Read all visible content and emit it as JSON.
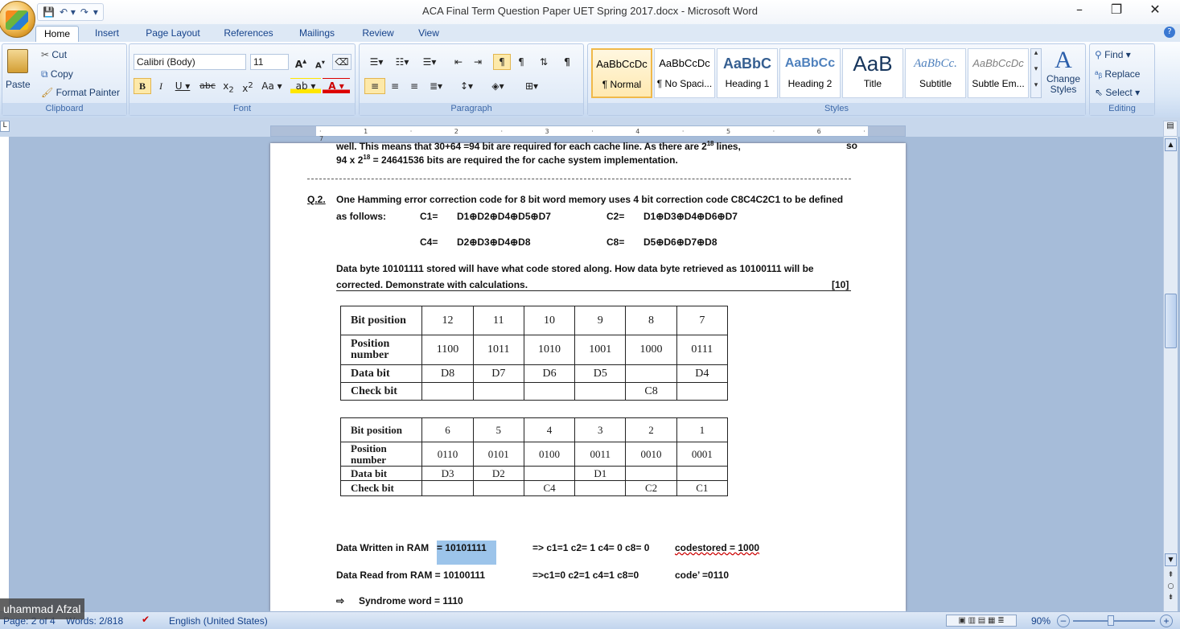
{
  "window": {
    "title": "ACA Final Term Question Paper UET Spring 2017.docx - Microsoft Word",
    "minimize": "–",
    "restore": "❐",
    "close": "✕"
  },
  "qat": {
    "save": "💾",
    "undo": "↶ ▾",
    "redo": "↷",
    "customize": "▾"
  },
  "tabs": [
    "Home",
    "Insert",
    "Page Layout",
    "References",
    "Mailings",
    "Review",
    "View"
  ],
  "clipboard": {
    "paste": "Paste",
    "cut": "Cut",
    "copy": "Copy",
    "format_painter": "Format Painter",
    "label": "Clipboard"
  },
  "font": {
    "name": "Calibri (Body)",
    "size": "11",
    "label": "Font"
  },
  "paragraph": {
    "label": "Paragraph"
  },
  "styles": {
    "label": "Styles",
    "tiles": [
      {
        "preview": "AaBbCcDc",
        "name": "¶ Normal"
      },
      {
        "preview": "AaBbCcDc",
        "name": "¶ No Spaci..."
      },
      {
        "preview": "AaBbC",
        "name": "Heading 1"
      },
      {
        "preview": "AaBbCc",
        "name": "Heading 2"
      },
      {
        "preview": "AaB",
        "name": "Title"
      },
      {
        "preview": "AaBbCc.",
        "name": "Subtitle"
      },
      {
        "preview": "AaBbCcDc",
        "name": "Subtle Em..."
      }
    ],
    "change": "Change Styles"
  },
  "editing": {
    "find": "Find",
    "replace": "Replace",
    "select": "Select",
    "label": "Editing"
  },
  "doc": {
    "line1_a": "well. This means that 30+64 =94 bit are required for each cache line. As there are 2",
    "line1_sup": "18",
    "line1_b": " lines,",
    "line1_end": "so",
    "line2_a": "94 x 2",
    "line2_sup": "18",
    "line2_b": "  =  24641536  bits are required the for cache system implementation.",
    "q2_num": "Q.2.",
    "q2_line1": "One Hamming error correction code for 8 bit word memory uses 4 bit correction code  C8C4C2C1 to be defined",
    "q2_asfollows": "as follows:",
    "c1_l": "C1=",
    "c1_v": "D1⊕D2⊕D4⊕D5⊕D7",
    "c2_l": "C2=",
    "c2_v": "D1⊕D3⊕D4⊕D6⊕D7",
    "c4_l": "C4=",
    "c4_v": "D2⊕D3⊕D4⊕D8",
    "c8_l": "C8=",
    "c8_v": "D5⊕D6⊕D7⊕D8",
    "data_line1": "Data byte  10101111 stored will have  what code  stored along. How data byte retrieved as 10100111 will be",
    "data_line2": "corrected. Demonstrate with calculations.",
    "marks": "[10]",
    "written_label": "Data Written in RAM",
    "written_value": "=  10101111",
    "written_calc": "=> c1=1  c2= 1    c4= 0  c8= 0",
    "written_code": "codestored = 1000",
    "read_label": "Data Read from RAM = 10100111",
    "read_calc": "=>c1=0  c2=1  c4=1   c8=0",
    "read_code": "code’          =0110",
    "syndrome_arrow": "⇨",
    "syndrome": "Syndrome word = 1110"
  },
  "table1": {
    "rows": [
      {
        "head": "Bit position",
        "cells": [
          "12",
          "11",
          "10",
          "9",
          "8",
          "7"
        ]
      },
      {
        "head": "Position number",
        "cells": [
          "1100",
          "1011",
          "1010",
          "1001",
          "1000",
          "0111"
        ]
      },
      {
        "head": "Data bit",
        "cells": [
          "D8",
          "D7",
          "D6",
          "D5",
          "",
          "D4"
        ]
      },
      {
        "head": "Check bit",
        "cells": [
          "",
          "",
          "",
          "",
          "C8",
          ""
        ]
      }
    ]
  },
  "table2": {
    "rows": [
      {
        "head": "Bit position",
        "cells": [
          "6",
          "5",
          "4",
          "3",
          "2",
          "1"
        ]
      },
      {
        "head": "Position number",
        "cells": [
          "0110",
          "0101",
          "0100",
          "0011",
          "0010",
          "0001"
        ]
      },
      {
        "head": "Data bit",
        "cells": [
          "D3",
          "D2",
          "",
          "D1",
          "",
          ""
        ]
      },
      {
        "head": "Check bit",
        "cells": [
          "",
          "",
          "C4",
          "",
          "C2",
          "C1"
        ]
      }
    ]
  },
  "status": {
    "page": "Page: 2 of 4",
    "words": "Words: 2/818",
    "language": "English (United States)",
    "zoom": "90%",
    "zoom_minus": "–",
    "zoom_plus": "+"
  },
  "overlay": {
    "name": "uhammad Afzal"
  }
}
